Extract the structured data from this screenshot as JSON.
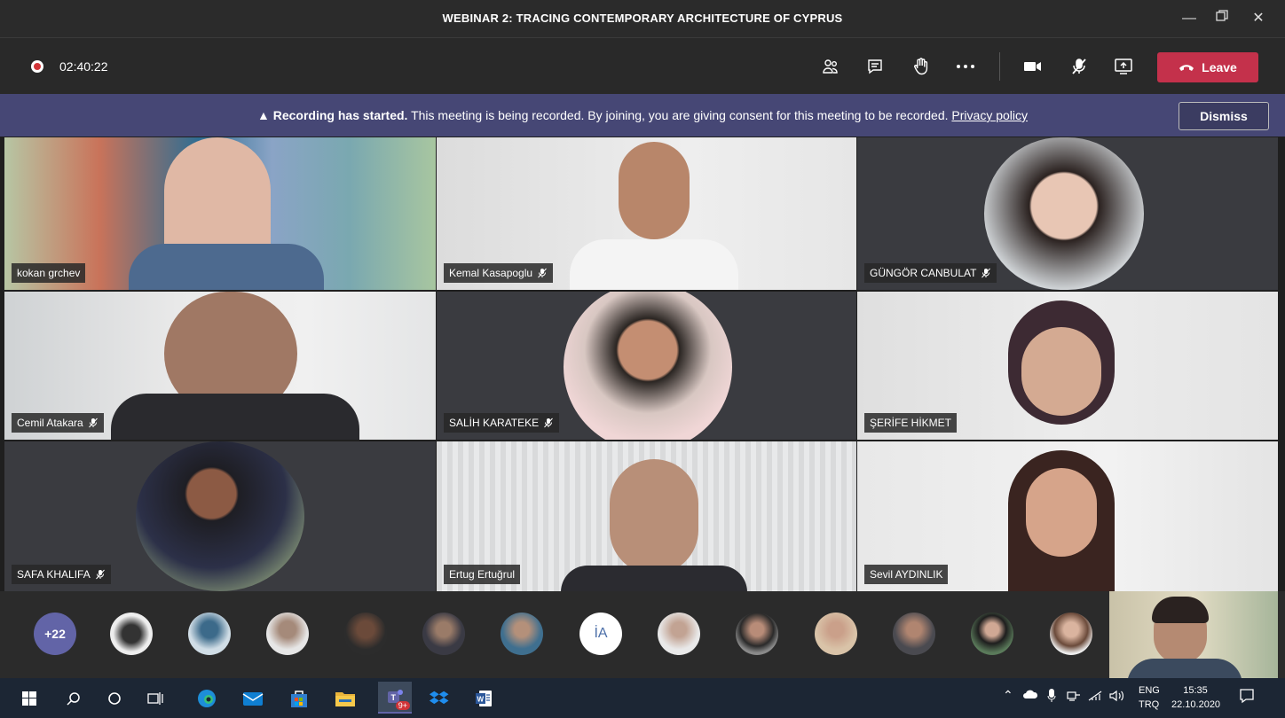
{
  "window": {
    "title": "WEBINAR 2: TRACING CONTEMPORARY ARCHITECTURE OF CYPRUS"
  },
  "toolbar": {
    "timer": "02:40:22",
    "leave_label": "Leave"
  },
  "banner": {
    "bold": "Recording has started.",
    "text": " This meeting is being recorded. By joining, you are giving consent for this meeting to be recorded. ",
    "link": "Privacy policy",
    "dismiss_label": "Dismiss"
  },
  "participants": [
    {
      "name": "kokan grchev",
      "muted": false
    },
    {
      "name": "Kemal Kasapoglu",
      "muted": true
    },
    {
      "name": "GÜNGÖR CANBULAT",
      "muted": true
    },
    {
      "name": "Cemil Atakara",
      "muted": true
    },
    {
      "name": "SALİH KARATEKE",
      "muted": true
    },
    {
      "name": "ŞERİFE HİKMET",
      "muted": false
    },
    {
      "name": "SAFA KHALIFA",
      "muted": true
    },
    {
      "name": "Ertug Ertuğrul",
      "muted": false
    },
    {
      "name": "Sevil AYDINLIK",
      "muted": false
    }
  ],
  "strip": {
    "overflow_count": "+22",
    "initials_avatar": "İA"
  },
  "taskbar": {
    "lang_top": "ENG",
    "lang_bottom": "TRQ",
    "time": "15:35",
    "date": "22.10.2020",
    "teams_badge": "9+"
  },
  "colors": {
    "leave": "#c4314b",
    "banner": "#464775",
    "accent": "#6264a7"
  }
}
